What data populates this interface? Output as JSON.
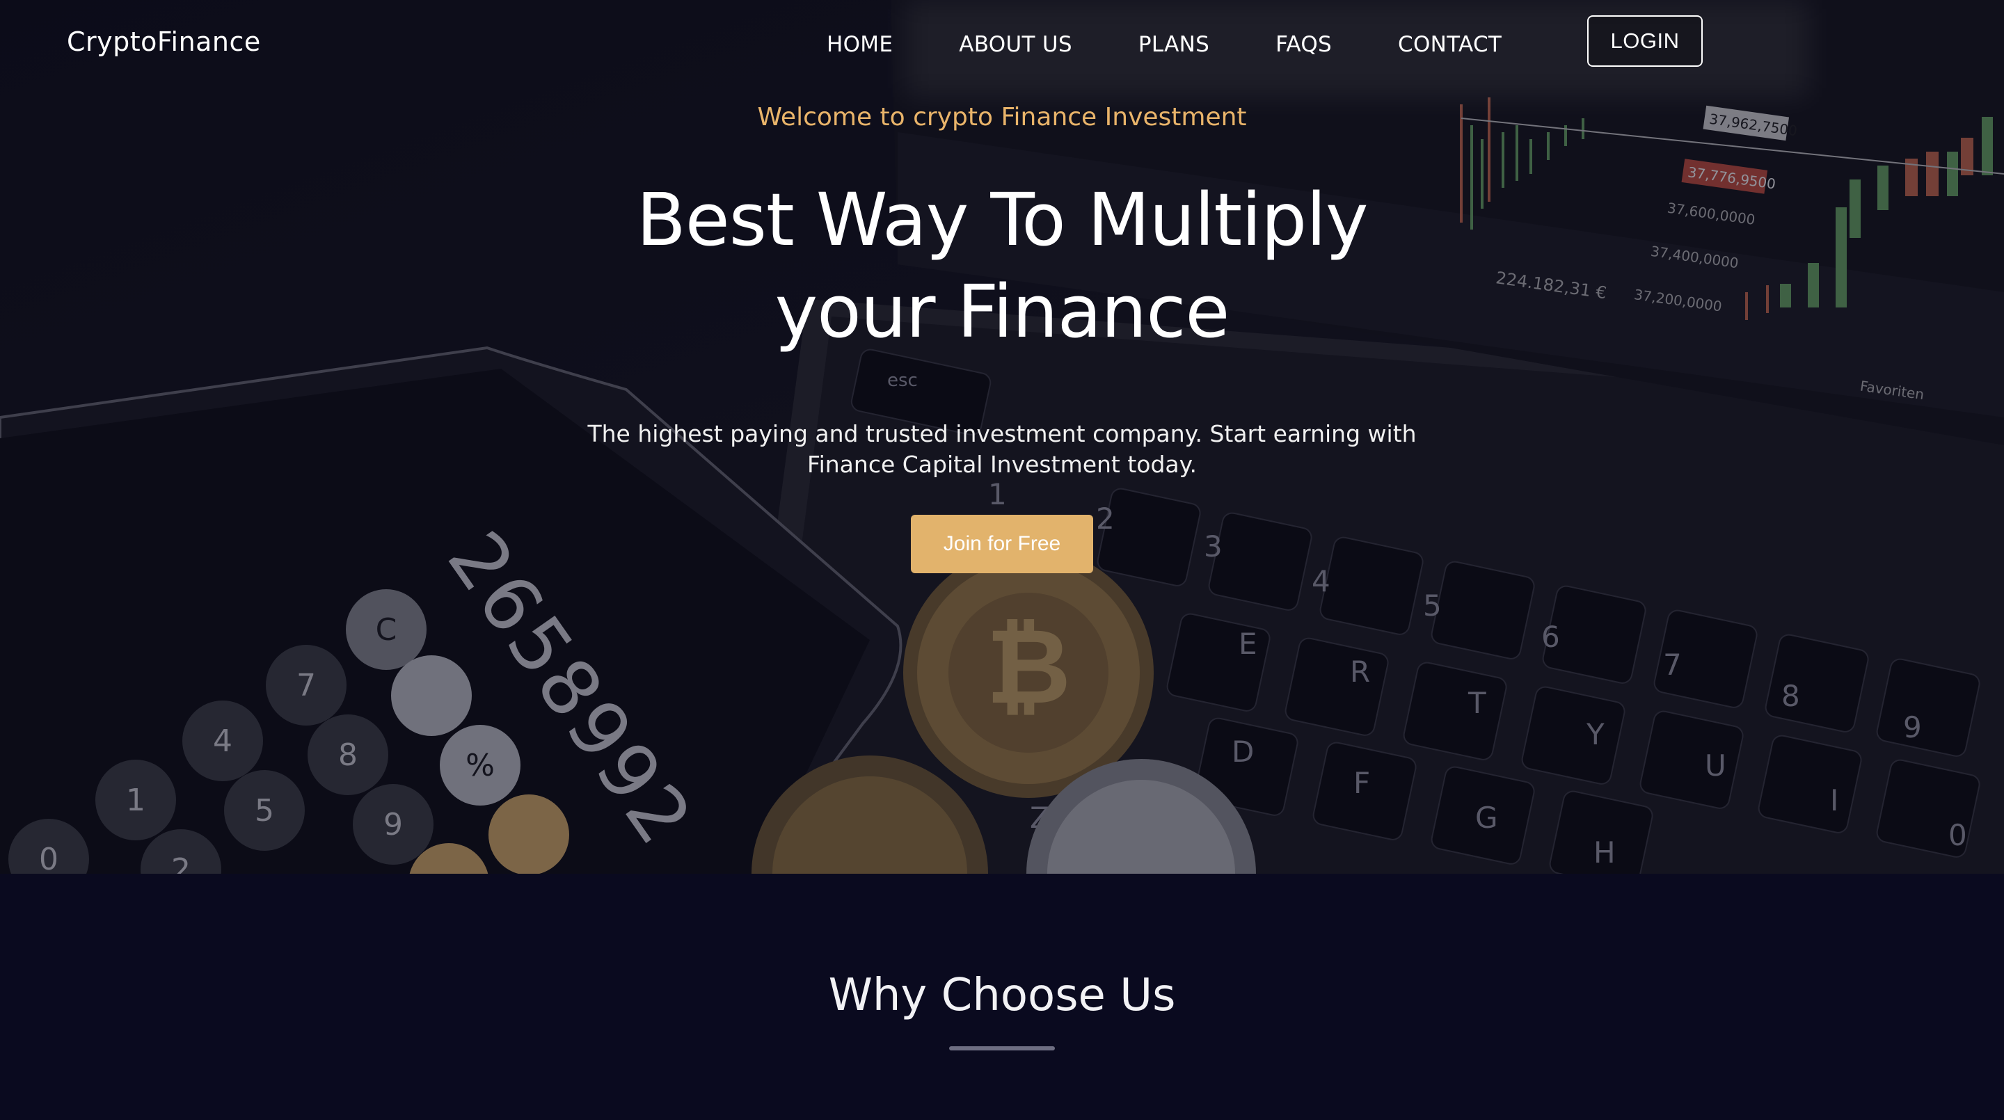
{
  "brand": "CryptoFinance",
  "nav": {
    "links": [
      "HOME",
      "ABOUT US",
      "PLANS",
      "FAQS",
      "CONTACT"
    ],
    "login_label": "LOGIN"
  },
  "hero": {
    "welcome": "Welcome to crypto Finance Investment",
    "headline": "Best Way To Multiply your Finance",
    "subtext": "The highest paying and trusted investment company. Start earning with Finance Capital Investment today.",
    "cta_label": "Join for Free"
  },
  "background": {
    "calculator_display": "2658992",
    "chart_prices": [
      "37,962,7500",
      "37,776,9500",
      "37,600,0000",
      "37,400,0000",
      "37,200,0000"
    ],
    "chart_total": "224.182,31 €",
    "chart_tab": "Favoriten",
    "calculator_keys": [
      "C",
      "7",
      "4",
      "1",
      "0",
      "8",
      "5",
      "2",
      "9",
      "%"
    ],
    "keyboard_keys": [
      "esc",
      "1",
      "2",
      "3",
      "4",
      "5",
      "6",
      "7",
      "8",
      "9",
      "0",
      "E",
      "R",
      "T",
      "Y",
      "U",
      "I",
      "D",
      "F",
      "G",
      "H",
      "Z"
    ],
    "colors": {
      "accent": "#e2b36c",
      "welcome": "#e9b46a",
      "section_bg": "#0a0a1f"
    }
  },
  "why": {
    "title": "Why Choose Us"
  }
}
